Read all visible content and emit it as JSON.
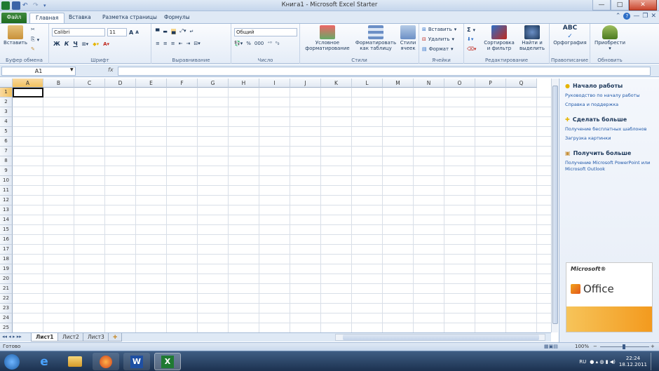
{
  "window": {
    "title": "Книга1 - Microsoft Excel Starter",
    "controls": {
      "minimize": "—",
      "maximize": "□",
      "close": "✕"
    }
  },
  "tabs": [
    "Файл",
    "Главная",
    "Вставка",
    "Разметка страницы",
    "Формулы"
  ],
  "active_tab": "Главная",
  "ribbon": {
    "clipboard": {
      "paste": "Вставить",
      "group": "Буфер обмена"
    },
    "font": {
      "name": "Calibri",
      "size": "11",
      "bold": "Ж",
      "italic": "К",
      "underline": "Ч",
      "grow": "A",
      "shrink": "A",
      "group": "Шрифт"
    },
    "alignment": {
      "group": "Выравнивание"
    },
    "number": {
      "format": "Общий",
      "percent": "%",
      "thousands": "000",
      "group": "Число"
    },
    "styles": {
      "conditional_1": "Условное",
      "conditional_2": "форматирование",
      "as_table_1": "Форматировать",
      "as_table_2": "как таблицу",
      "cell_styles_1": "Стили",
      "cell_styles_2": "ячеек",
      "group": "Стили"
    },
    "cells": {
      "insert": "Вставить",
      "delete": "Удалить",
      "format": "Формат",
      "group": "Ячейки"
    },
    "editing": {
      "sort_1": "Сортировка",
      "sort_2": "и фильтр",
      "find_1": "Найти и",
      "find_2": "выделить",
      "sigma": "Σ",
      "group": "Редактирование"
    },
    "proofing": {
      "abc": "ABC",
      "spelling": "Орфография",
      "group": "Правописание"
    },
    "update": {
      "purchase": "Приобрести",
      "group": "Обновить"
    }
  },
  "formula_bar": {
    "name_box": "A1",
    "fx": "fx",
    "value": ""
  },
  "grid": {
    "columns": [
      "A",
      "B",
      "C",
      "D",
      "E",
      "F",
      "G",
      "H",
      "I",
      "J",
      "K",
      "L",
      "M",
      "N",
      "O",
      "P",
      "Q"
    ],
    "rows": [
      "1",
      "2",
      "3",
      "4",
      "5",
      "6",
      "7",
      "8",
      "9",
      "10",
      "11",
      "12",
      "13",
      "14",
      "15",
      "16",
      "17",
      "18",
      "19",
      "20",
      "21",
      "22",
      "23",
      "24",
      "25"
    ],
    "active_cell": "A1"
  },
  "sheets": [
    "Лист1",
    "Лист2",
    "Лист3"
  ],
  "active_sheet": "Лист1",
  "status": {
    "ready": "Готово",
    "zoom": "100%",
    "zoom_minus": "−",
    "zoom_plus": "+"
  },
  "side_panel": {
    "get_started": {
      "title": "Начало работы",
      "links": [
        "Руководство по началу работы",
        "Справка и поддержка"
      ]
    },
    "do_more": {
      "title": "Сделать больше",
      "links": [
        "Получение бесплатных шаблонов",
        "Загрузка картинки"
      ]
    },
    "get_more": {
      "title": "Получить больше",
      "links": [
        "Получение Microsoft PowerPoint или",
        "Microsoft Outlook"
      ]
    },
    "ad": {
      "brand": "Microsoft®",
      "product": "Office"
    }
  },
  "taskbar": {
    "lang": "RU",
    "time": "22:24",
    "date": "18.12.2011",
    "apps": [
      "start-orb",
      "internet-explorer-icon",
      "file-explorer-icon",
      "firefox-icon",
      "word-icon",
      "excel-icon"
    ]
  }
}
